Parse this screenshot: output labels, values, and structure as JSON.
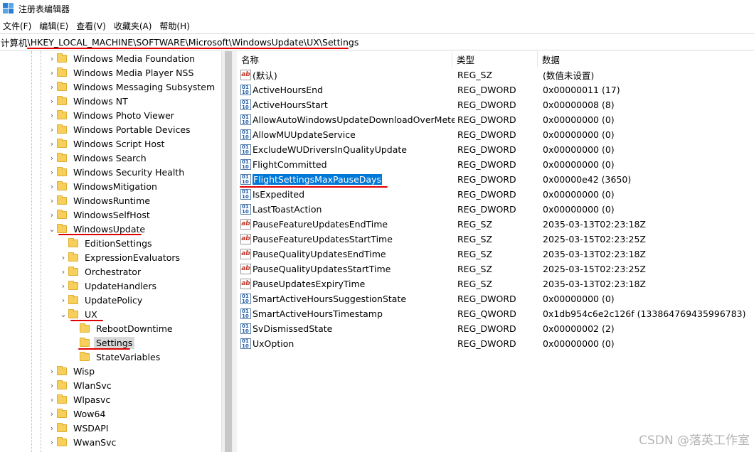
{
  "window": {
    "title": "注册表编辑器"
  },
  "menu": [
    "文件(F)",
    "编辑(E)",
    "查看(V)",
    "收藏夹(A)",
    "帮助(H)"
  ],
  "address": {
    "root": "计算机",
    "sep": "\\",
    "path": "HKEY_LOCAL_MACHINE\\SOFTWARE\\Microsoft\\WindowsUpdate\\UX\\Settings"
  },
  "tree": [
    {
      "label": "Windows Media Foundation",
      "level": 0,
      "expander": "›"
    },
    {
      "label": "Windows Media Player NSS",
      "level": 0,
      "expander": "›"
    },
    {
      "label": "Windows Messaging Subsystem",
      "level": 0,
      "expander": "›"
    },
    {
      "label": "Windows NT",
      "level": 0,
      "expander": "›"
    },
    {
      "label": "Windows Photo Viewer",
      "level": 0,
      "expander": "›"
    },
    {
      "label": "Windows Portable Devices",
      "level": 0,
      "expander": "›"
    },
    {
      "label": "Windows Script Host",
      "level": 0,
      "expander": "›"
    },
    {
      "label": "Windows Search",
      "level": 0,
      "expander": "›"
    },
    {
      "label": "Windows Security Health",
      "level": 0,
      "expander": "›"
    },
    {
      "label": "WindowsMitigation",
      "level": 0,
      "expander": "›"
    },
    {
      "label": "WindowsRuntime",
      "level": 0,
      "expander": "›"
    },
    {
      "label": "WindowsSelfHost",
      "level": 0,
      "expander": "›"
    },
    {
      "label": "WindowsUpdate",
      "level": 0,
      "expander": "⌄"
    },
    {
      "label": "EditionSettings",
      "level": 1,
      "expander": ""
    },
    {
      "label": "ExpressionEvaluators",
      "level": 1,
      "expander": "›"
    },
    {
      "label": "Orchestrator",
      "level": 1,
      "expander": "›"
    },
    {
      "label": "UpdateHandlers",
      "level": 1,
      "expander": "›"
    },
    {
      "label": "UpdatePolicy",
      "level": 1,
      "expander": "›"
    },
    {
      "label": "UX",
      "level": 1,
      "expander": "⌄"
    },
    {
      "label": "RebootDowntime",
      "level": 2,
      "expander": ""
    },
    {
      "label": "Settings",
      "level": 2,
      "expander": "",
      "selected": true
    },
    {
      "label": "StateVariables",
      "level": 2,
      "expander": ""
    },
    {
      "label": "Wisp",
      "level": 0,
      "expander": "›"
    },
    {
      "label": "WlanSvc",
      "level": 0,
      "expander": "›"
    },
    {
      "label": "Wlpasvc",
      "level": 0,
      "expander": "›"
    },
    {
      "label": "Wow64",
      "level": 0,
      "expander": "›"
    },
    {
      "label": "WSDAPI",
      "level": 0,
      "expander": "›"
    },
    {
      "label": "WwanSvc",
      "level": 0,
      "expander": "›"
    }
  ],
  "columns": {
    "name": "名称",
    "type": "类型",
    "data": "数据"
  },
  "values": [
    {
      "name": "(默认)",
      "type": "REG_SZ",
      "data": "(数值未设置)",
      "icon": "ab"
    },
    {
      "name": "ActiveHoursEnd",
      "type": "REG_DWORD",
      "data": "0x00000011 (17)",
      "icon": "bin"
    },
    {
      "name": "ActiveHoursStart",
      "type": "REG_DWORD",
      "data": "0x00000008 (8)",
      "icon": "bin"
    },
    {
      "name": "AllowAutoWindowsUpdateDownloadOverMete...",
      "type": "REG_DWORD",
      "data": "0x00000000 (0)",
      "icon": "bin"
    },
    {
      "name": "AllowMUUpdateService",
      "type": "REG_DWORD",
      "data": "0x00000000 (0)",
      "icon": "bin"
    },
    {
      "name": "ExcludeWUDriversInQualityUpdate",
      "type": "REG_DWORD",
      "data": "0x00000000 (0)",
      "icon": "bin"
    },
    {
      "name": "FlightCommitted",
      "type": "REG_DWORD",
      "data": "0x00000000 (0)",
      "icon": "bin"
    },
    {
      "name": "FlightSettingsMaxPauseDays",
      "type": "REG_DWORD",
      "data": "0x00000e42 (3650)",
      "icon": "bin",
      "selected": true
    },
    {
      "name": "IsExpedited",
      "type": "REG_DWORD",
      "data": "0x00000000 (0)",
      "icon": "bin"
    },
    {
      "name": "LastToastAction",
      "type": "REG_DWORD",
      "data": "0x00000000 (0)",
      "icon": "bin"
    },
    {
      "name": "PauseFeatureUpdatesEndTime",
      "type": "REG_SZ",
      "data": "2035-03-13T02:23:18Z",
      "icon": "ab"
    },
    {
      "name": "PauseFeatureUpdatesStartTime",
      "type": "REG_SZ",
      "data": "2025-03-15T02:23:25Z",
      "icon": "ab"
    },
    {
      "name": "PauseQualityUpdatesEndTime",
      "type": "REG_SZ",
      "data": "2035-03-13T02:23:18Z",
      "icon": "ab"
    },
    {
      "name": "PauseQualityUpdatesStartTime",
      "type": "REG_SZ",
      "data": "2025-03-15T02:23:25Z",
      "icon": "ab"
    },
    {
      "name": "PauseUpdatesExpiryTime",
      "type": "REG_SZ",
      "data": "2035-03-13T02:23:18Z",
      "icon": "ab"
    },
    {
      "name": "SmartActiveHoursSuggestionState",
      "type": "REG_DWORD",
      "data": "0x00000000 (0)",
      "icon": "bin"
    },
    {
      "name": "SmartActiveHoursTimestamp",
      "type": "REG_QWORD",
      "data": "0x1db954c6e2c126f (133864769435996783)",
      "icon": "bin"
    },
    {
      "name": "SvDismissedState",
      "type": "REG_DWORD",
      "data": "0x00000002 (2)",
      "icon": "bin"
    },
    {
      "name": "UxOption",
      "type": "REG_DWORD",
      "data": "0x00000000 (0)",
      "icon": "bin"
    }
  ],
  "watermark": "CSDN @落英工作室",
  "colors": {
    "annotation": "#e00000",
    "selection": "#0078d7",
    "folder": "#f7cf5d"
  }
}
